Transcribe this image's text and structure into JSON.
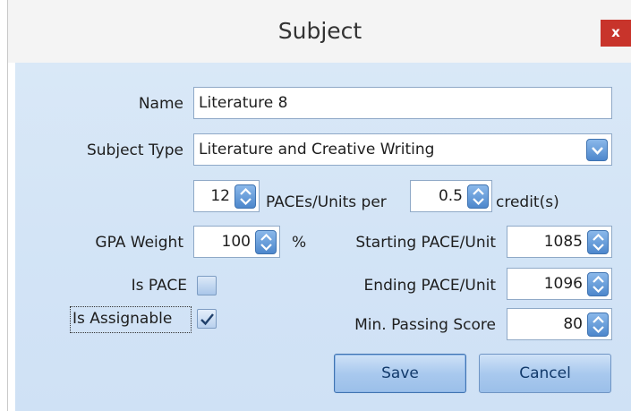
{
  "window": {
    "title": "Subject",
    "close_label": "x"
  },
  "form": {
    "name_label": "Name",
    "name_value": "Literature 8",
    "subject_type_label": "Subject Type",
    "subject_type_value": "Literature and Creative Writing",
    "paces_count": "12",
    "paces_per_label": "PACEs/Units per",
    "credit_value": "0.5",
    "credit_label": "credit(s)",
    "gpa_weight_label": "GPA Weight",
    "gpa_weight_value": "100",
    "percent_label": "%",
    "starting_pace_label": "Starting PACE/Unit",
    "starting_pace_value": "1085",
    "ending_pace_label": "Ending PACE/Unit",
    "ending_pace_value": "1096",
    "min_passing_label": "Min. Passing Score",
    "min_passing_value": "80",
    "is_pace_label": "Is PACE",
    "is_pace_checked": false,
    "is_assignable_label": "Is Assignable",
    "is_assignable_checked": true
  },
  "buttons": {
    "save": "Save",
    "cancel": "Cancel"
  },
  "colors": {
    "panel": "#d6e6f7",
    "accent": "#4d87cc",
    "close": "#c8342b"
  }
}
